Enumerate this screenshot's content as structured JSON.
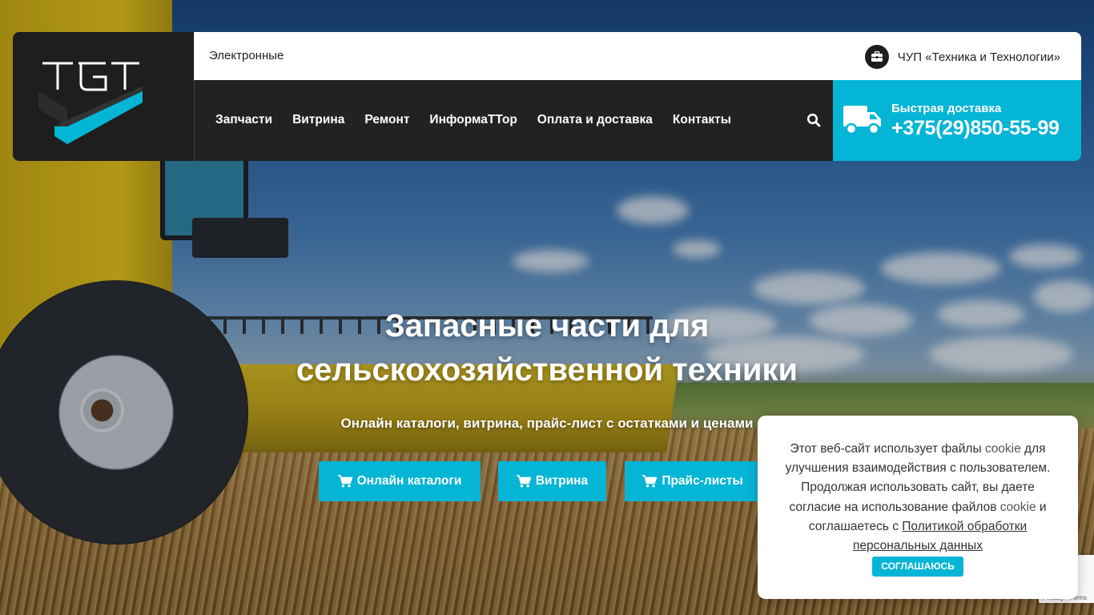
{
  "topbar": {
    "left_text": "Электронные",
    "company_name": "ЧУП «Техника и Технологии»",
    "company_icon": "briefcase-icon"
  },
  "nav": {
    "items": [
      {
        "label": "Запчасти"
      },
      {
        "label": "Витрина"
      },
      {
        "label": "Ремонт"
      },
      {
        "label": "ИнформаТТор"
      },
      {
        "label": "Оплата и доставка"
      },
      {
        "label": "Контакты"
      }
    ],
    "search_icon": "search-icon"
  },
  "delivery": {
    "label": "Быстрая доставка",
    "phone": "+375(29)850-55-99",
    "icon": "truck-icon"
  },
  "hero": {
    "title_line1": "Запасные части для",
    "title_line2": "сельскохозяйственной техники",
    "subtitle": "Онлайн каталоги, витрина, прайс-лист с остатками и ценами",
    "buttons": [
      {
        "label": "Онлайн каталоги",
        "icon": "cart-icon"
      },
      {
        "label": "Витрина",
        "icon": "cart-icon"
      },
      {
        "label": "Прайс-листы",
        "icon": "cart-icon"
      }
    ]
  },
  "cookie": {
    "text_1": "Этот веб-сайт использует файлы ",
    "cookie_word_1": "cookie",
    "text_2": " для улучшения взаимодействия с пользователем. Продолжая использовать сайт, вы даете согласие на использование файлов ",
    "cookie_word_2": "cookie",
    "text_3": " и соглашаетесь с ",
    "policy_link": "Политикой обработки персональных данных",
    "accept_button": "СОГЛАШАЮСЬ"
  },
  "recaptcha": {
    "text": "Privacy - Terms"
  },
  "colors": {
    "accent": "#04b5d6",
    "dark": "#222222",
    "logo_bg": "#1e1e1e"
  }
}
